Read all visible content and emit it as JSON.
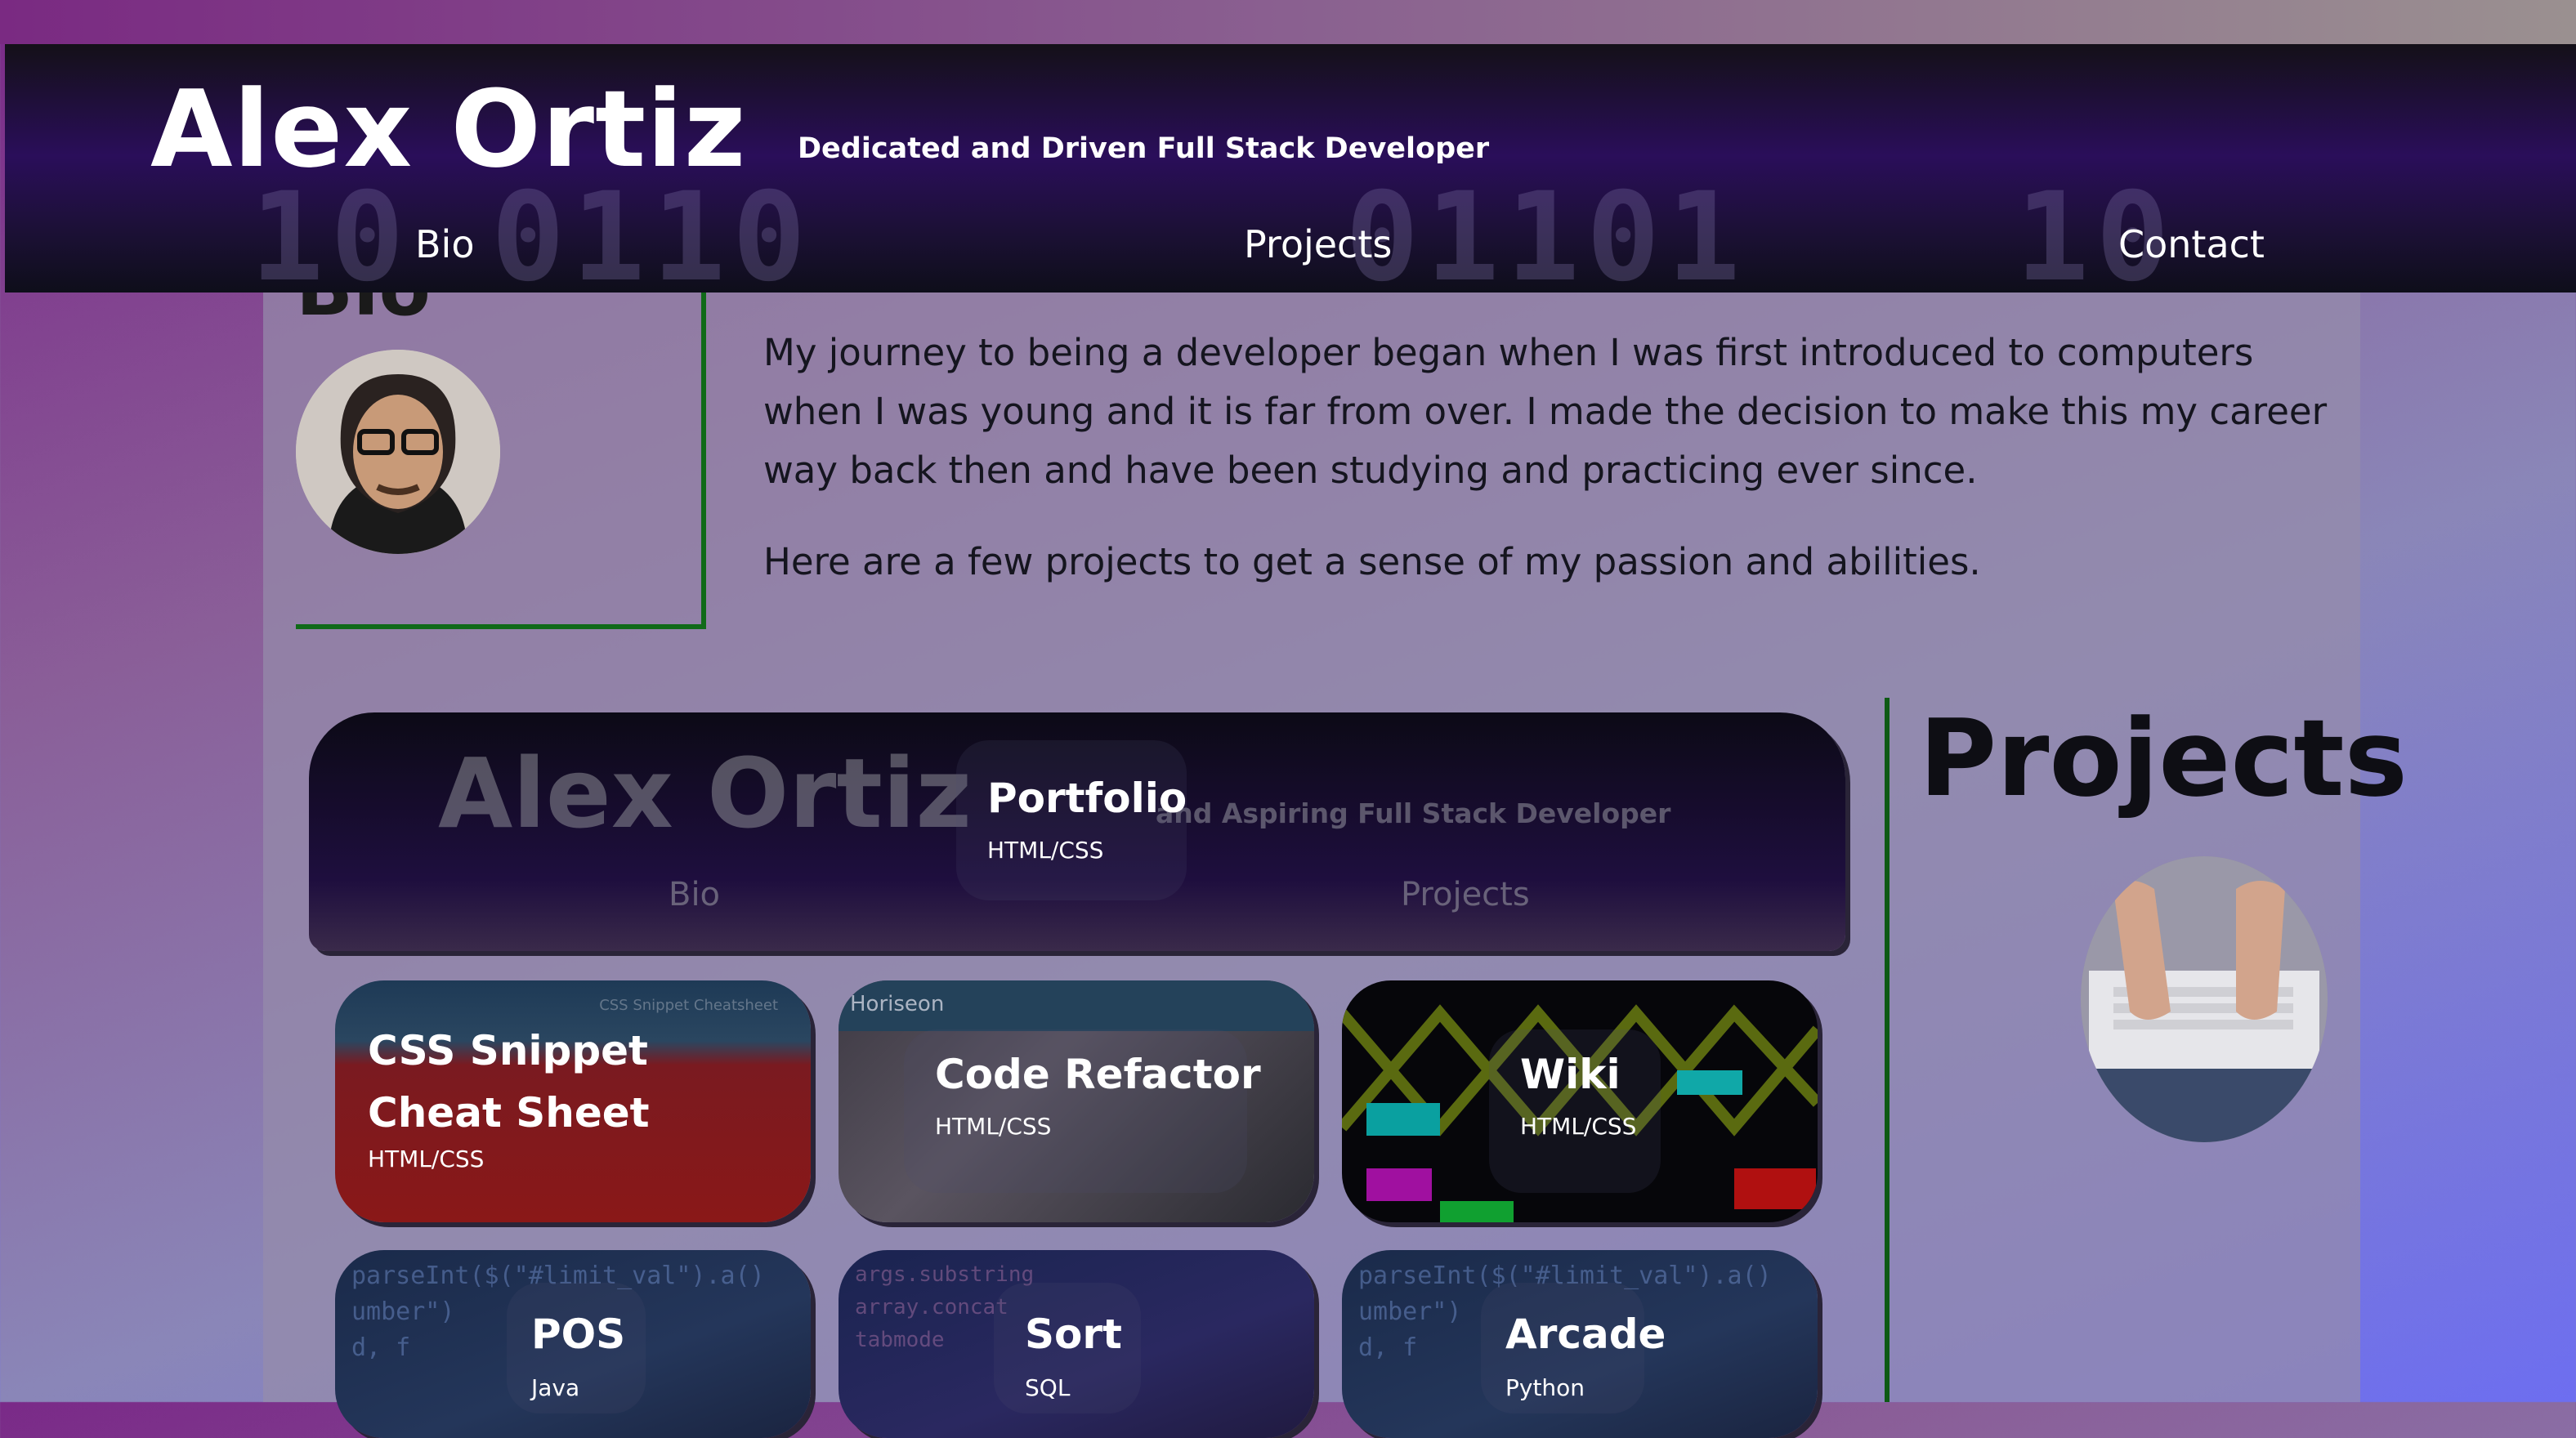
{
  "header": {
    "title": "Alex Ortiz",
    "tagline": "Dedicated and Driven Full Stack Developer",
    "nav": [
      "Bio",
      "Projects",
      "Contact"
    ]
  },
  "bio": {
    "heading": "Bio",
    "paragraph1": "My journey to being a developer began when I was first introduced to computers when I was young and it is far from over. I made the decision to make this my career way back then and have been studying and practicing ever since.",
    "paragraph2": "Here are a few projects to get a sense of my passion and abilities."
  },
  "projects": {
    "heading": "Projects",
    "featured": {
      "title": "Portfolio",
      "lang": "HTML/CSS",
      "preview_title": "Alex Ortiz",
      "preview_tagline": "and Aspiring Full Stack Developer",
      "preview_nav": [
        "Bio",
        "Projects"
      ]
    },
    "items": [
      {
        "title": "CSS Snippet Cheat Sheet",
        "lang": "HTML/CSS",
        "preview": "CSS Snippet Cheatsheet"
      },
      {
        "title": "Code Refactor",
        "lang": "HTML/CSS",
        "preview": "Horiseon"
      },
      {
        "title": "Wiki",
        "lang": "HTML/CSS"
      },
      {
        "title": "POS",
        "lang": "Java"
      },
      {
        "title": "Sort",
        "lang": "SQL"
      },
      {
        "title": "Arcade",
        "lang": "Python"
      }
    ]
  },
  "colors": {
    "accent_border": "#106a18",
    "header_dark": "#1c1036",
    "text_dark": "#15151f"
  }
}
